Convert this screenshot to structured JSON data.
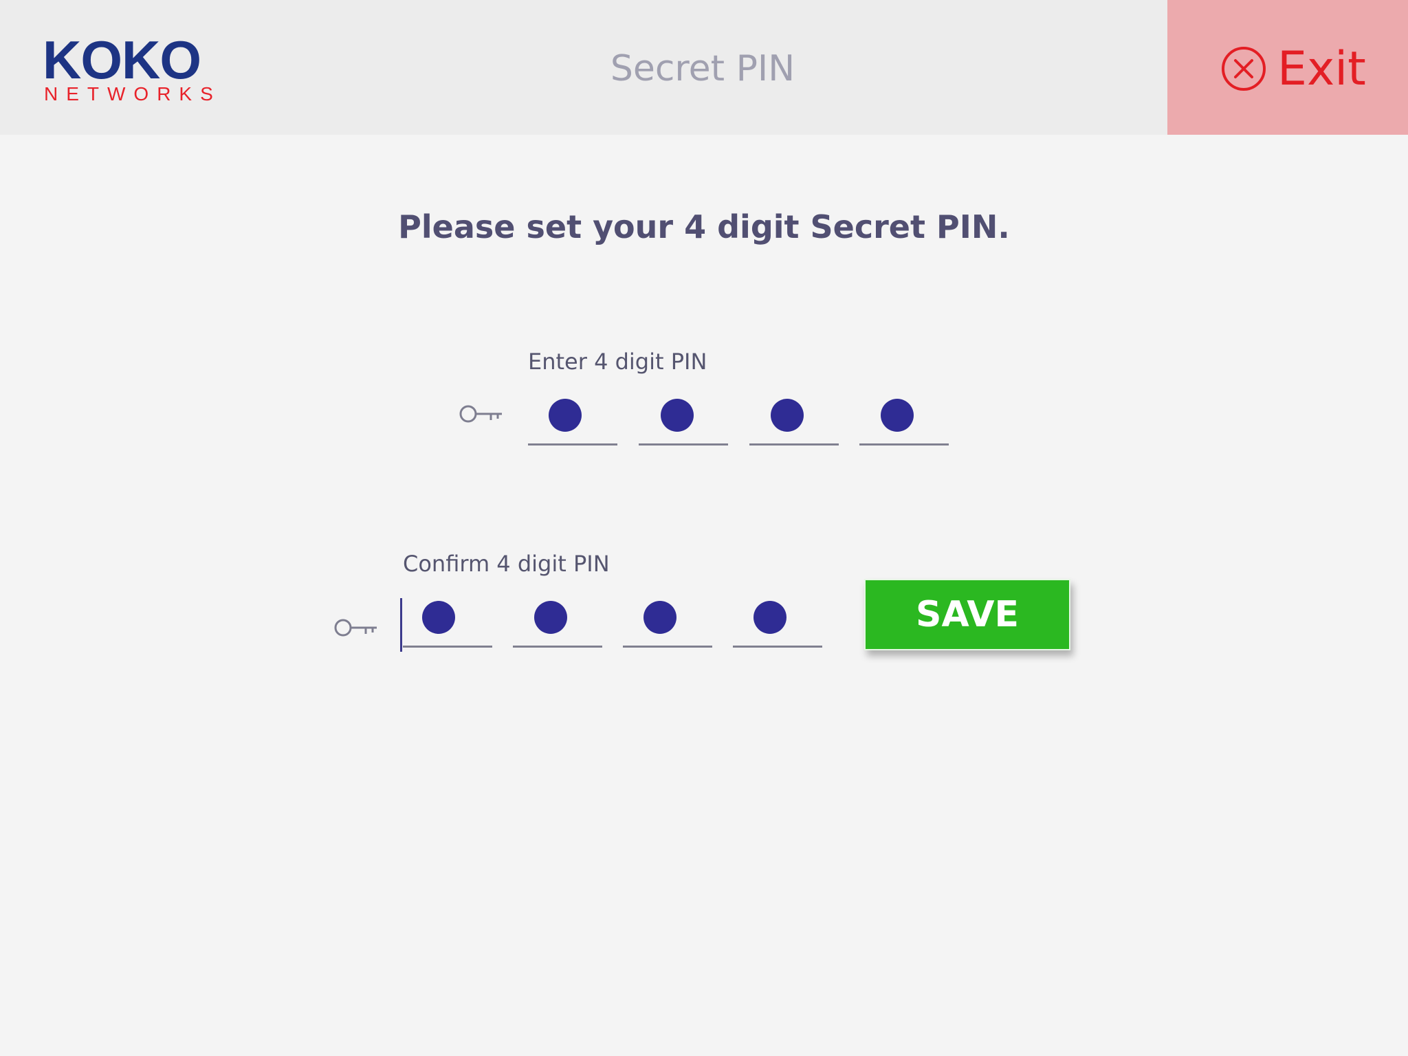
{
  "logo": {
    "top": "KOKO",
    "bottom": "NETWORKS"
  },
  "header": {
    "title": "Secret PIN",
    "exit_label": "Exit"
  },
  "colors": {
    "exit_red": "#e31e24",
    "exit_bg": "#ecaaad",
    "pin_dot": "#2f2c94",
    "save_green": "#2bb821",
    "brand_blue": "#1d3484"
  },
  "instruction": "Please set your 4 digit Secret PIN.",
  "pin": {
    "label": "Enter 4 digit PIN",
    "digits_entered": 4,
    "length": 4,
    "icon": "key-icon"
  },
  "confirm": {
    "label": "Confirm 4 digit PIN",
    "digits_entered": 4,
    "length": 4,
    "icon": "key-icon"
  },
  "save_label": "SAVE"
}
